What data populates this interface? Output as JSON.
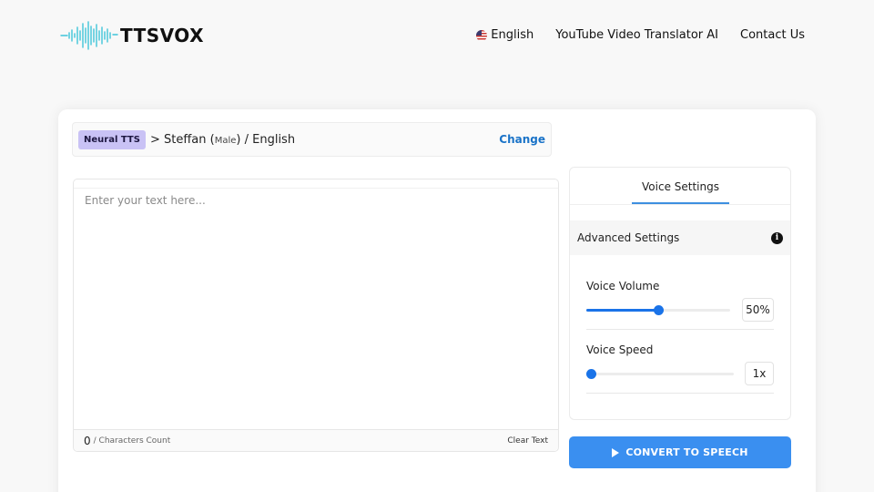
{
  "header": {
    "logo_text": "TTSVOX",
    "nav": {
      "language": "English",
      "translator": "YouTube Video Translator AI",
      "contact": "Contact Us"
    }
  },
  "voice": {
    "badge": "Neural TTS",
    "separator": ">",
    "name": "Steffan",
    "gender": "Male",
    "language": "English",
    "change_label": "Change"
  },
  "editor": {
    "placeholder": "Enter your text here...",
    "char_count": "0",
    "char_count_label": "/ Characters Count",
    "clear_label": "Clear Text"
  },
  "settings": {
    "tab_label": "Voice Settings",
    "advanced_label": "Advanced Settings",
    "info_icon": "i",
    "volume": {
      "label": "Voice Volume",
      "value_text": "50%",
      "level": 0.5
    },
    "speed": {
      "label": "Voice Speed",
      "value_text": "1x",
      "level": 0.0
    }
  },
  "convert_button": {
    "label": "CONVERT TO SPEECH"
  },
  "colors": {
    "accent": "#1a73e8",
    "button": "#3a8ff0",
    "badge": "#c9c2f5",
    "logo_wave": "#3fc4d9"
  }
}
